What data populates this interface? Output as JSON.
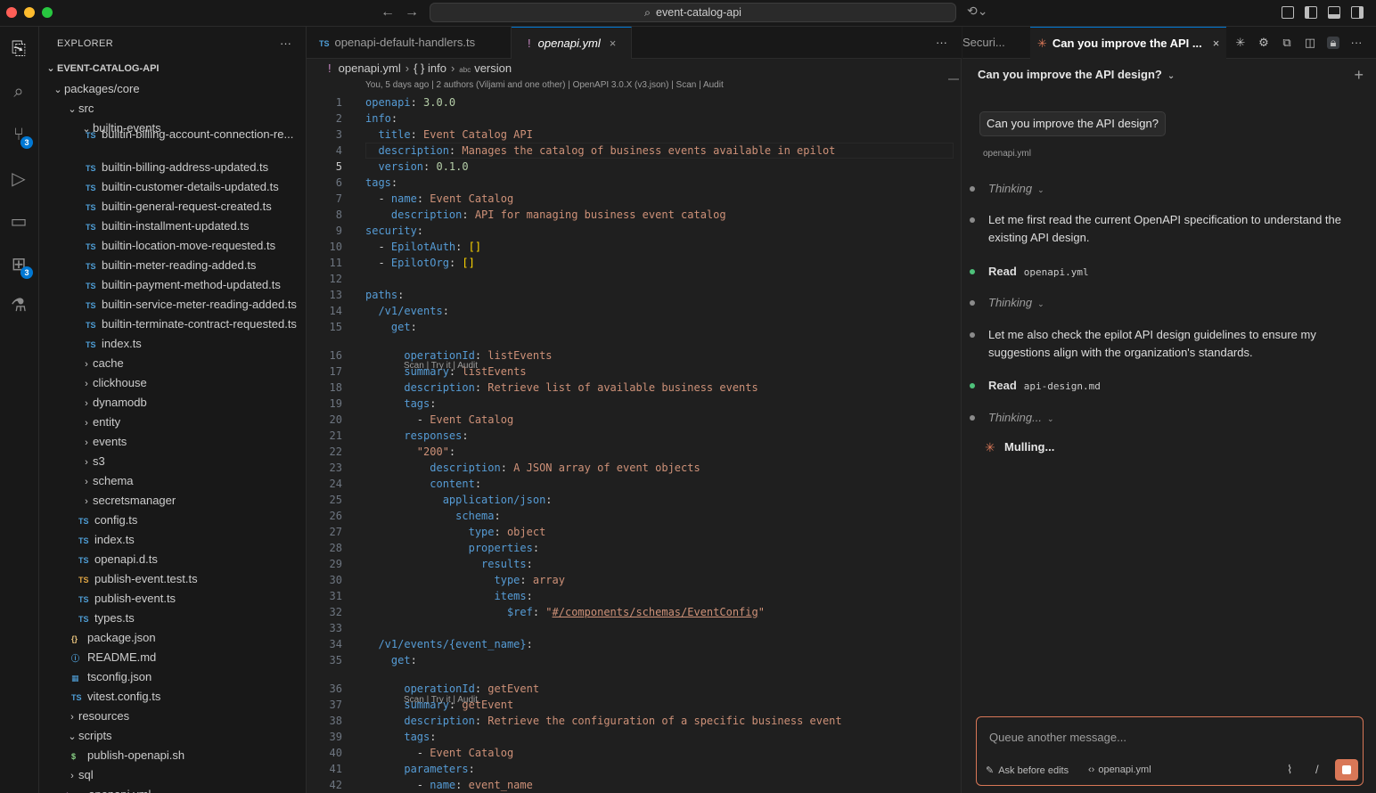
{
  "titlebar": {
    "search_text": "event-catalog-api"
  },
  "activity": {
    "scm_badge": "3",
    "ext_badge": "3"
  },
  "explorer": {
    "header": "EXPLORER",
    "root": "EVENT-CATALOG-API",
    "items": [
      {
        "label": "packages/core",
        "type": "folder-open"
      },
      {
        "label": "src",
        "type": "folder-open"
      },
      {
        "label": "builtin-events",
        "type": "folder-open"
      },
      {
        "label": "builtin-billing-account-connection-re...",
        "type": "ts"
      },
      {
        "label": "builtin-billing-address-updated.ts",
        "type": "ts"
      },
      {
        "label": "builtin-customer-details-updated.ts",
        "type": "ts"
      },
      {
        "label": "builtin-general-request-created.ts",
        "type": "ts"
      },
      {
        "label": "builtin-installment-updated.ts",
        "type": "ts"
      },
      {
        "label": "builtin-location-move-requested.ts",
        "type": "ts"
      },
      {
        "label": "builtin-meter-reading-added.ts",
        "type": "ts"
      },
      {
        "label": "builtin-payment-method-updated.ts",
        "type": "ts"
      },
      {
        "label": "builtin-service-meter-reading-added.ts",
        "type": "ts"
      },
      {
        "label": "builtin-terminate-contract-requested.ts",
        "type": "ts"
      },
      {
        "label": "index.ts",
        "type": "ts"
      },
      {
        "label": "cache",
        "type": "folder"
      },
      {
        "label": "clickhouse",
        "type": "folder"
      },
      {
        "label": "dynamodb",
        "type": "folder"
      },
      {
        "label": "entity",
        "type": "folder"
      },
      {
        "label": "events",
        "type": "folder"
      },
      {
        "label": "s3",
        "type": "folder"
      },
      {
        "label": "schema",
        "type": "folder"
      },
      {
        "label": "secretsmanager",
        "type": "folder"
      },
      {
        "label": "config.ts",
        "type": "ts"
      },
      {
        "label": "index.ts",
        "type": "ts"
      },
      {
        "label": "openapi.d.ts",
        "type": "ts"
      },
      {
        "label": "publish-event.test.ts",
        "type": "ts-test"
      },
      {
        "label": "publish-event.ts",
        "type": "ts"
      },
      {
        "label": "types.ts",
        "type": "ts"
      },
      {
        "label": "package.json",
        "type": "json"
      },
      {
        "label": "README.md",
        "type": "info"
      },
      {
        "label": "tsconfig.json",
        "type": "tsconfig"
      },
      {
        "label": "vitest.config.ts",
        "type": "ts"
      },
      {
        "label": "resources",
        "type": "folder"
      },
      {
        "label": "scripts",
        "type": "folder-open"
      },
      {
        "label": "publish-openapi.sh",
        "type": "sh"
      },
      {
        "label": "sql",
        "type": "folder"
      },
      {
        "label": "_openapi.yml",
        "type": "yml"
      }
    ]
  },
  "editor": {
    "tabs": [
      {
        "label": "openapi-default-handlers.ts",
        "icon": "TS"
      },
      {
        "label": "openapi.yml",
        "icon": "!",
        "close": "×"
      }
    ],
    "breadcrumb": {
      "file": "openapi.yml",
      "sym1": "{ } info",
      "sym2": "version"
    },
    "blame": "You, 5 days ago | 2 authors (Viljami and one other) | OpenAPI 3.0.X (v3.json) | Scan | Audit",
    "lens": "Scan | Try it | Audit"
  },
  "chat": {
    "tab_prev": "Securi...",
    "tab_active": "Can you improve the API ...",
    "title": "Can you improve the API design?",
    "user_message": "Can you improve the API design?",
    "attachment": "openapi.yml",
    "steps": {
      "thinking1": "Thinking",
      "msg1": "Let me first read the current OpenAPI specification to understand the existing API design.",
      "read_label": "Read",
      "read1_file": "openapi.yml",
      "thinking2": "Thinking",
      "msg2": "Let me also check the epilot API design guidelines to ensure my suggestions align with the organization's standards.",
      "read2_file": "api-design.md",
      "thinking3": "Thinking...",
      "mulling": "Mulling..."
    },
    "composer": {
      "placeholder": "Queue another message...",
      "mode": "Ask before edits",
      "file": "openapi.yml"
    }
  }
}
